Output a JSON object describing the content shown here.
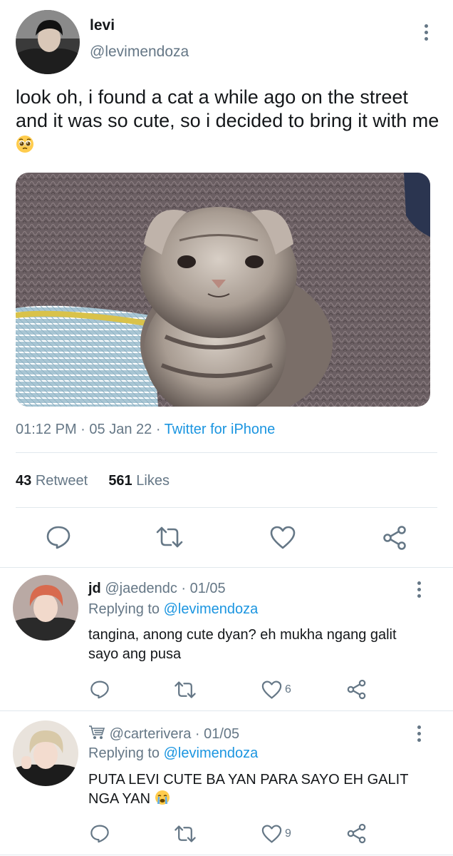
{
  "tweet": {
    "name": "levi",
    "handle": "@levimendoza",
    "text": "look oh, i found a cat a while ago on the street and it was so cute, so i decided to bring it with me",
    "emoji": "pleading-face",
    "time": "01:12 PM",
    "date": "05 Jan 22",
    "source": "Twitter for iPhone",
    "retweet_count": "43",
    "retweet_label": "Retweet",
    "likes_count": "561",
    "likes_label": "Likes"
  },
  "replies": [
    {
      "name": "jd",
      "handle": "@jaedendc",
      "date": "01/05",
      "replying_prefix": "Replying to",
      "replying_to": "@levimendoza",
      "text": "tangina, anong cute dyan? eh mukha ngang galit sayo ang pusa",
      "like_count": "6"
    },
    {
      "name_emoji": "shopping-cart",
      "handle": "@carterivera",
      "date": "01/05",
      "replying_prefix": "Replying to",
      "replying_to": "@levimendoza",
      "text": "PUTA LEVI CUTE BA YAN PARA SAYO EH GALIT NGA YAN",
      "emoji": "crying-face",
      "like_count": "9"
    }
  ],
  "colors": {
    "text": "#14171a",
    "secondary": "#657786",
    "link": "#1b95e0",
    "divider": "#e1e8ed"
  }
}
